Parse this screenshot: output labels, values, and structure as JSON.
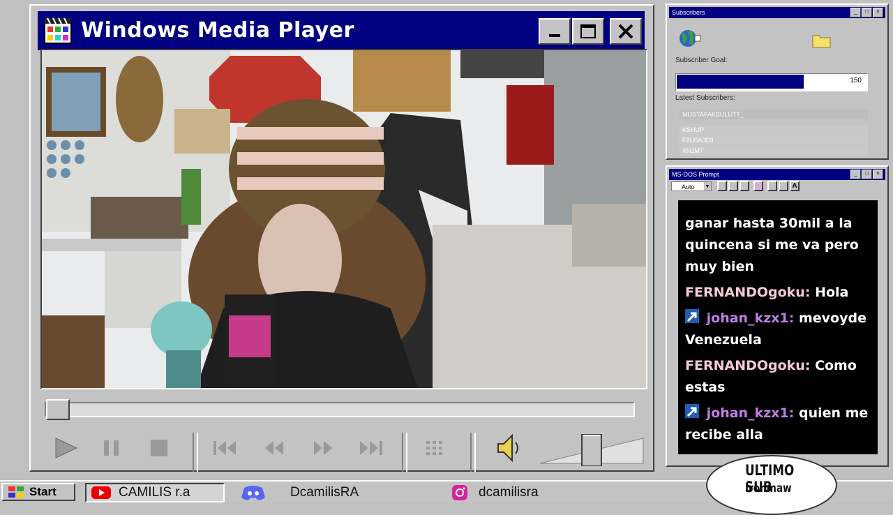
{
  "wmp": {
    "title": "Windows Media Player",
    "controls": [
      "play-icon",
      "pause-icon",
      "stop-icon",
      "skip-back-icon",
      "rewind-icon",
      "fast-forward-icon",
      "skip-forward-icon",
      "playlist-icon",
      "speaker-icon"
    ],
    "seek_fraction": 0.0
  },
  "subscribers": {
    "title": "Subscribers",
    "goal_label": "Subscriber Goal:",
    "goal_value": "150",
    "goal_fraction": 0.67,
    "latest_label": "Latest Subscribers:",
    "latest": [
      "MUSTAFAKBULUTT_",
      "KSHUP",
      "F2U0A0D3",
      "XN1M7"
    ]
  },
  "dos": {
    "title": "MS-DOS Prompt",
    "font_select": "Auto",
    "chat": [
      {
        "user": "",
        "color": "#ffffff",
        "badge": false,
        "text": "ganar hasta 30mil a la quincena si me va pero muy bien"
      },
      {
        "user": "FERNANDOgoku:",
        "color": "#f6c9dd",
        "badge": false,
        "text": "Hola"
      },
      {
        "user": "johan_kzx1:",
        "color": "#c17ee8",
        "badge": true,
        "text": "mevoyde Venezuela"
      },
      {
        "user": "FERNANDOgoku:",
        "color": "#f6c9dd",
        "badge": false,
        "text": "Como estas"
      },
      {
        "user": "johan_kzx1:",
        "color": "#c17ee8",
        "badge": true,
        "text": "quien me recibe alla"
      }
    ]
  },
  "taskbar": {
    "start": "Start",
    "youtube": "CAMILIS r.a",
    "discord": "DcamilisRA",
    "instagram": "dcamilisra"
  },
  "last_sub": {
    "title": "ULTIMO SUB",
    "name": "Ironmaw"
  }
}
